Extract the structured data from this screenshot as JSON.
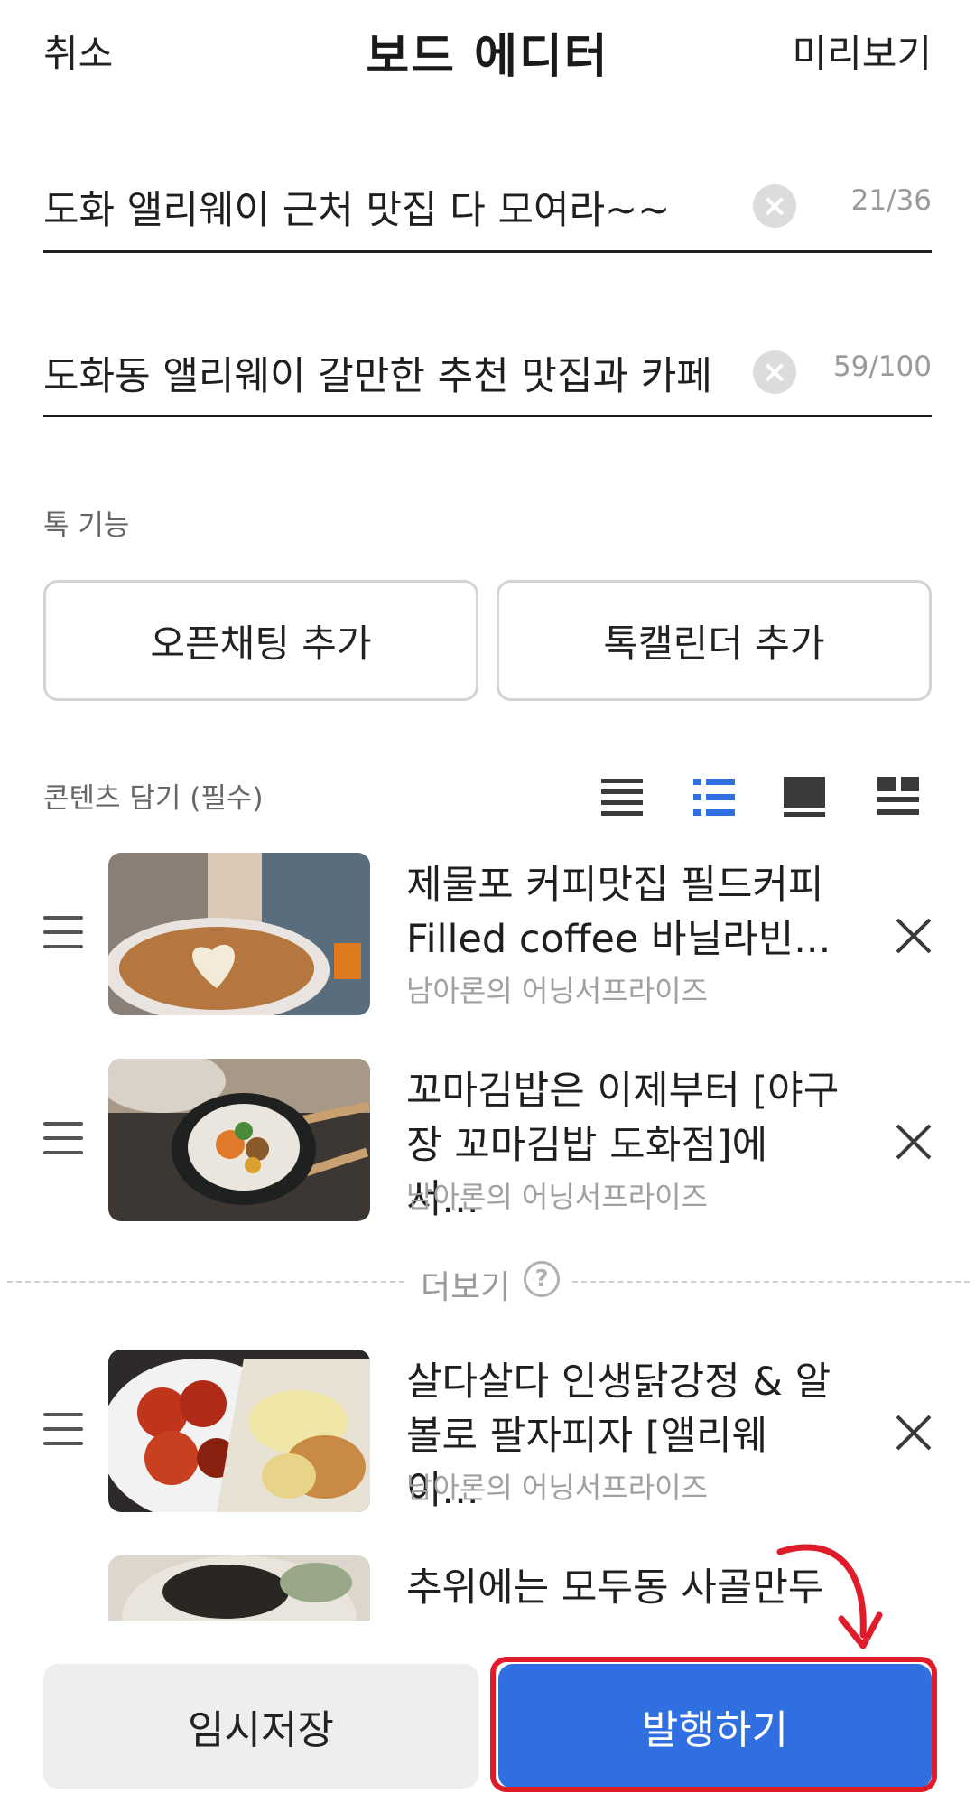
{
  "header": {
    "cancel_label": "취소",
    "title": "보드 에디터",
    "preview_label": "미리보기"
  },
  "title_field": {
    "value": "도화 앨리웨이 근처 맛집 다 모여라~~",
    "counter": "21/36"
  },
  "desc_field": {
    "value": "도화동 앨리웨이 갈만한 추천 맛집과 카페",
    "counter": "59/100"
  },
  "talk_section": {
    "label": "톡 기능",
    "open_chat_button": "오픈채팅 추가",
    "talk_calendar_button": "톡캘린더 추가"
  },
  "content_section": {
    "label": "콘텐츠 담기 (필수)",
    "view_modes": [
      "list-compact",
      "list-thumbnail",
      "card",
      "grid"
    ],
    "selected_view_mode": "list-thumbnail",
    "accent_color": "#2f6fe0"
  },
  "items": [
    {
      "title": "제물포 커피맛집 필드커피 Filled coffee 바닐라빈...",
      "source": "남아론의 어닝서프라이즈",
      "thumb": "latte-art-coffee"
    },
    {
      "title": "꼬마김밥은 이제부터 [야구장 꼬마김밥 도화점]에서...",
      "source": "남아론의 어닝서프라이즈",
      "thumb": "kimbap"
    },
    {
      "title": "살다살다 인생닭강정 & 알볼로 팔자피자 [앨리웨이...",
      "source": "남아론의 어닝서프라이즈",
      "thumb": "chicken-and-pizza"
    },
    {
      "title": "추위에는 모두동 사골만두",
      "source": "",
      "thumb": "dumpling-soup"
    }
  ],
  "more_divider": {
    "label": "더보기",
    "help": "?"
  },
  "bottom": {
    "save_label": "임시저장",
    "publish_label": "발행하기",
    "publish_color": "#2f6fe0",
    "highlight_color": "#e01c2b"
  }
}
